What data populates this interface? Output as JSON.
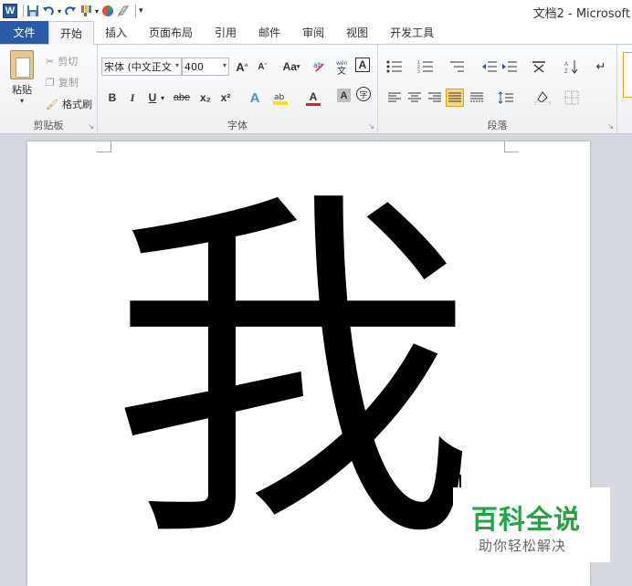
{
  "window": {
    "title": "文档2 - Microsoft"
  },
  "quick_access": {
    "logo_letter": "W"
  },
  "tabs": [
    {
      "label": "文件"
    },
    {
      "label": "开始"
    },
    {
      "label": "插入"
    },
    {
      "label": "页面布局"
    },
    {
      "label": "引用"
    },
    {
      "label": "邮件"
    },
    {
      "label": "审阅"
    },
    {
      "label": "视图"
    },
    {
      "label": "开发工具"
    }
  ],
  "clipboard": {
    "paste": "粘贴",
    "cut": "剪切",
    "copy": "复制",
    "format_painter": "格式刷",
    "group_label": "剪贴板"
  },
  "font": {
    "font_name": "宋体 (中文正文",
    "font_size": "400",
    "grow": "A",
    "shrink": "A",
    "change_case": "Aa",
    "bold": "B",
    "italic": "I",
    "underline": "U",
    "strike": "abe",
    "subscript": "x₂",
    "superscript": "x²",
    "font_color": "A",
    "char_shading": "A",
    "enclose": "字",
    "group_label": "字体"
  },
  "paragraph": {
    "group_label": "段落"
  },
  "document": {
    "content": "我"
  },
  "watermark": {
    "title": "百科全说",
    "subtitle": "助你轻松解决"
  },
  "colors": {
    "file_tab": "#2a5ba8",
    "watermark_green": "#22a346",
    "highlight": "#fbd97a"
  }
}
